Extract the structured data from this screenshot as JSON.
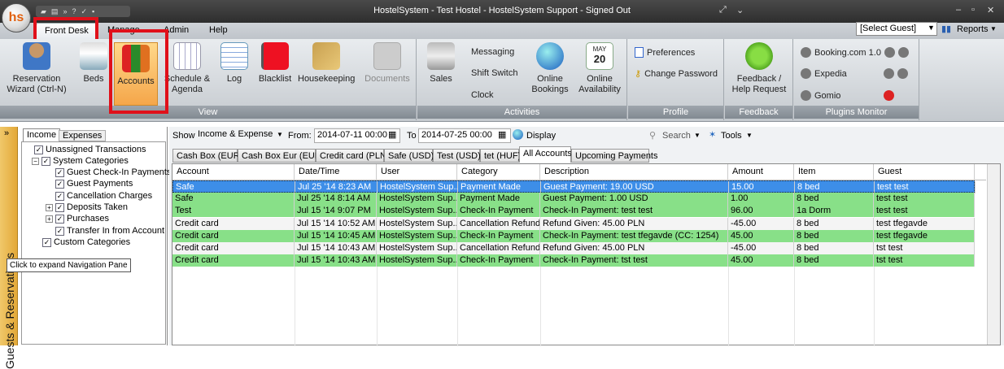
{
  "window": {
    "title": "HostelSystem - Test Hostel - HostelSystem Support - Signed Out",
    "logo": "hs"
  },
  "menu": {
    "tabs": [
      "Front Desk",
      "Manage",
      "Admin",
      "Help"
    ],
    "guest_select": "[Select Guest]",
    "reports": "Reports"
  },
  "ribbon": {
    "view": {
      "label": "View",
      "buttons": [
        "Reservation Wizard (Ctrl-N)",
        "Beds",
        "Accounts",
        "Schedule & Agenda",
        "Log",
        "Blacklist",
        "Housekeeping",
        "Documents"
      ]
    },
    "activities": {
      "label": "Activities",
      "sales": "Sales",
      "small": [
        "Messaging",
        "Shift Switch",
        "Clock"
      ],
      "buttons": [
        "Online Bookings",
        "Online Availability"
      ],
      "calendar": {
        "month": "MAY",
        "day": "20"
      }
    },
    "profile": {
      "label": "Profile",
      "items": [
        "Preferences",
        "Change Password"
      ]
    },
    "feedback": {
      "label": "Feedback",
      "button": "Feedback / Help Request"
    },
    "plugins": {
      "label": "Plugins Monitor",
      "items": [
        "Booking.com 1.0",
        "Expedia",
        "Gomio"
      ]
    }
  },
  "nav": {
    "tabs": [
      "Income",
      "Expenses"
    ],
    "vertical_label": "Guests & Reservations",
    "tooltip": "Click to expand Navigation Pane",
    "tree": [
      "Unassigned Transactions",
      "System Categories",
      "Guest Check-In Payments",
      "Guest Payments",
      "Cancellation Charges",
      "Deposits Taken",
      "Purchases",
      "Transfer In from Account",
      "Custom Categories"
    ]
  },
  "toolbar": {
    "show_label": "Show",
    "show_value": "Income & Expense",
    "from_label": "From:",
    "from_value": "2014-07-11 00:00",
    "to_label": "To",
    "to_value": "2014-07-25 00:00",
    "display": "Display",
    "search": "Search",
    "tools": "Tools"
  },
  "account_tabs": [
    "Cash Box (EUR)",
    "Cash Box Eur (EUR)",
    "Credit card (PLN)",
    "Safe (USD)",
    "Test (USD)",
    "tet (HUF)",
    "All Accounts",
    "Upcoming Payments"
  ],
  "grid": {
    "columns": [
      "Account",
      "Date/Time",
      "User",
      "Category",
      "Description",
      "Amount",
      "Item",
      "Guest"
    ],
    "rows": [
      [
        "Safe",
        "Jul 25 '14 8:23 AM",
        "HostelSystem Sup...",
        "Payment Made",
        "Guest Payment: 19.00 USD",
        "15.00",
        "8 bed",
        "test test"
      ],
      [
        "Safe",
        "Jul 25 '14 8:14 AM",
        "HostelSystem Sup...",
        "Payment Made",
        "Guest Payment: 1.00 USD",
        "1.00",
        "8 bed",
        "test test"
      ],
      [
        "Test",
        "Jul 15 '14 9:07 PM",
        "HostelSystem Sup...",
        "Check-In Payment",
        "Check-In Payment: test test",
        "96.00",
        "1a Dorm",
        "test test"
      ],
      [
        "Credit card",
        "Jul 15 '14 10:52 AM",
        "HostelSystem Sup...",
        "Cancellation Refund",
        "Refund Given: 45.00 PLN",
        "-45.00",
        "8 bed",
        "test tfegavde"
      ],
      [
        "Credit card",
        "Jul 15 '14 10:45 AM",
        "HostelSystem Sup...",
        "Check-In Payment",
        "Check-In Payment: test tfegavde (CC: 1254)",
        "45.00",
        "8 bed",
        "test tfegavde"
      ],
      [
        "Credit card",
        "Jul 15 '14 10:43 AM",
        "HostelSystem Sup...",
        "Cancellation Refund",
        "Refund Given: 45.00 PLN",
        "-45.00",
        "8 bed",
        "tst test"
      ],
      [
        "Credit card",
        "Jul 15 '14 10:43 AM",
        "HostelSystem Sup...",
        "Check-In Payment",
        "Check-In Payment: tst test",
        "45.00",
        "8 bed",
        "tst test"
      ]
    ],
    "row_colors": [
      "#3d8ee8",
      "#88e088",
      "#88e088",
      "#f4f4f4",
      "#88e088",
      "#f4f4f4",
      "#88e088"
    ]
  }
}
